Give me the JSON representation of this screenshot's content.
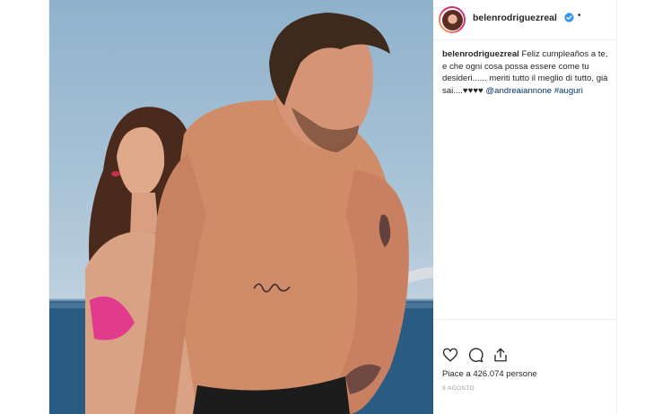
{
  "post": {
    "username": "belenrodriguezreal",
    "separator": "•",
    "caption": {
      "user": "belenrodriguezreal",
      "text": "Feliz cumpleaños a te, e che ogni cosa possa essere come tu desideri...... meriti tutto il meglio di tutto, già sai....♥♥♥♥",
      "mention": "@andreaiannone",
      "hashtag": "#auguri"
    },
    "likes_text": "Piace a 426.074 persone",
    "date": "9 AGOSTO"
  },
  "icons": {
    "like": "heart-icon",
    "comment": "comment-icon",
    "share": "share-icon",
    "verified": "verified-badge-icon"
  },
  "colors": {
    "verified_blue": "#3897f0",
    "link": "#003569",
    "border": "#efefef",
    "meta_gray": "#999999"
  }
}
